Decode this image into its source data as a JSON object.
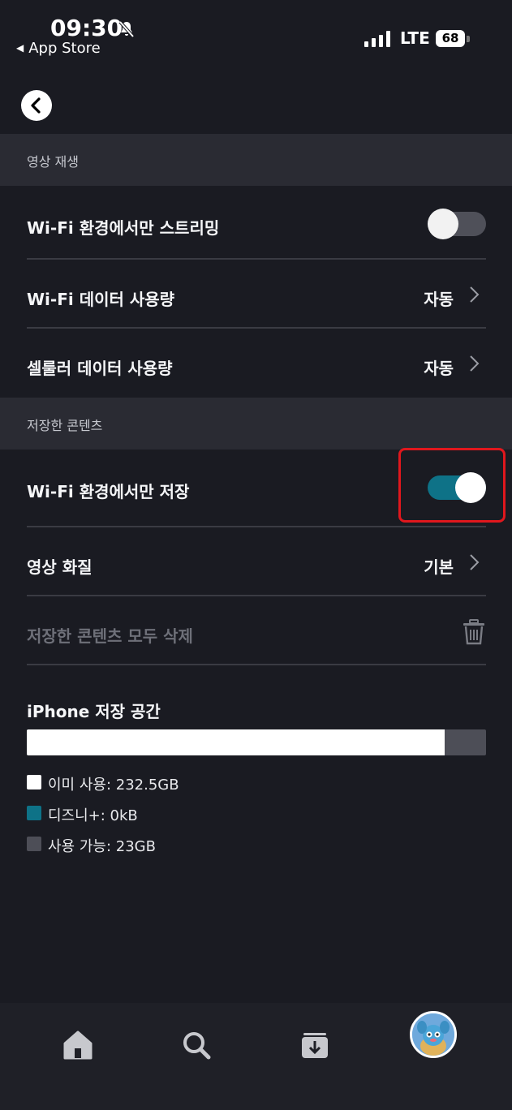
{
  "status_bar": {
    "time": "09:30",
    "back_app": "App Store",
    "network": "LTE",
    "battery": "68"
  },
  "sections": {
    "playback": {
      "title": "영상 재생",
      "wifi_stream_label": "Wi-Fi 환경에서만 스트리밍",
      "wifi_stream_on": false,
      "wifi_data_label": "Wi-Fi 데이터 사용량",
      "wifi_data_value": "자동",
      "cellular_data_label": "셀룰러 데이터 사용량",
      "cellular_data_value": "자동"
    },
    "downloads": {
      "title": "저장한 콘텐츠",
      "wifi_download_label": "Wi-Fi 환경에서만 저장",
      "wifi_download_on": true,
      "video_quality_label": "영상 화질",
      "video_quality_value": "기본",
      "delete_all_label": "저장한 콘텐츠 모두 삭제"
    }
  },
  "storage": {
    "title": "iPhone 저장 공간",
    "used_fraction": 0.91,
    "legend": [
      {
        "label": "이미 사용: 232.5GB",
        "color": "#ffffff"
      },
      {
        "label": "디즈니+: 0kB",
        "color": "#0e7287"
      },
      {
        "label": "사용 가능: 23GB",
        "color": "#4d4e57"
      }
    ]
  },
  "nav": {
    "items": [
      "home-icon",
      "search-icon",
      "downloads-icon",
      "profile-avatar"
    ]
  }
}
